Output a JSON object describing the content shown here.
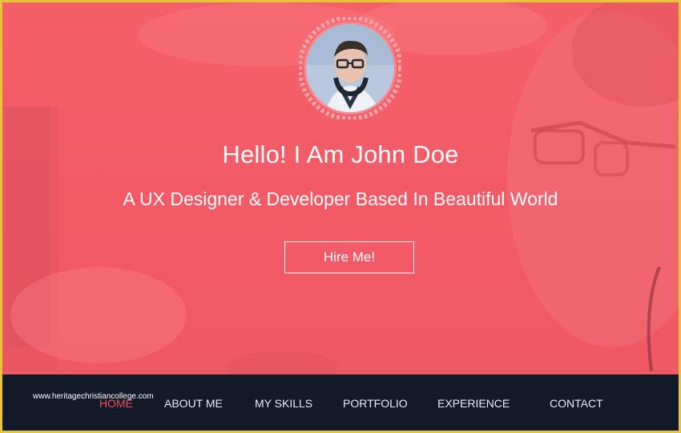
{
  "hero": {
    "title": "Hello! I Am John Doe",
    "subtitle": "A UX Designer & Developer Based In Beautiful World",
    "cta_label": "Hire Me!",
    "overlay_color": "#f25a66",
    "avatar_ring_color": "#f7a5a8"
  },
  "nav": {
    "items": [
      {
        "label": "HOME",
        "active": true
      },
      {
        "label": "ABOUT ME",
        "active": false
      },
      {
        "label": "MY SKILLS",
        "active": false
      },
      {
        "label": "PORTFOLIO",
        "active": false
      },
      {
        "label": "EXPERIENCE",
        "active": false
      },
      {
        "label": "CONTACT",
        "active": false
      }
    ],
    "background": "#121a2a",
    "active_color": "#ef4e5a"
  },
  "watermark": "www.heritagechristiancollege.com"
}
